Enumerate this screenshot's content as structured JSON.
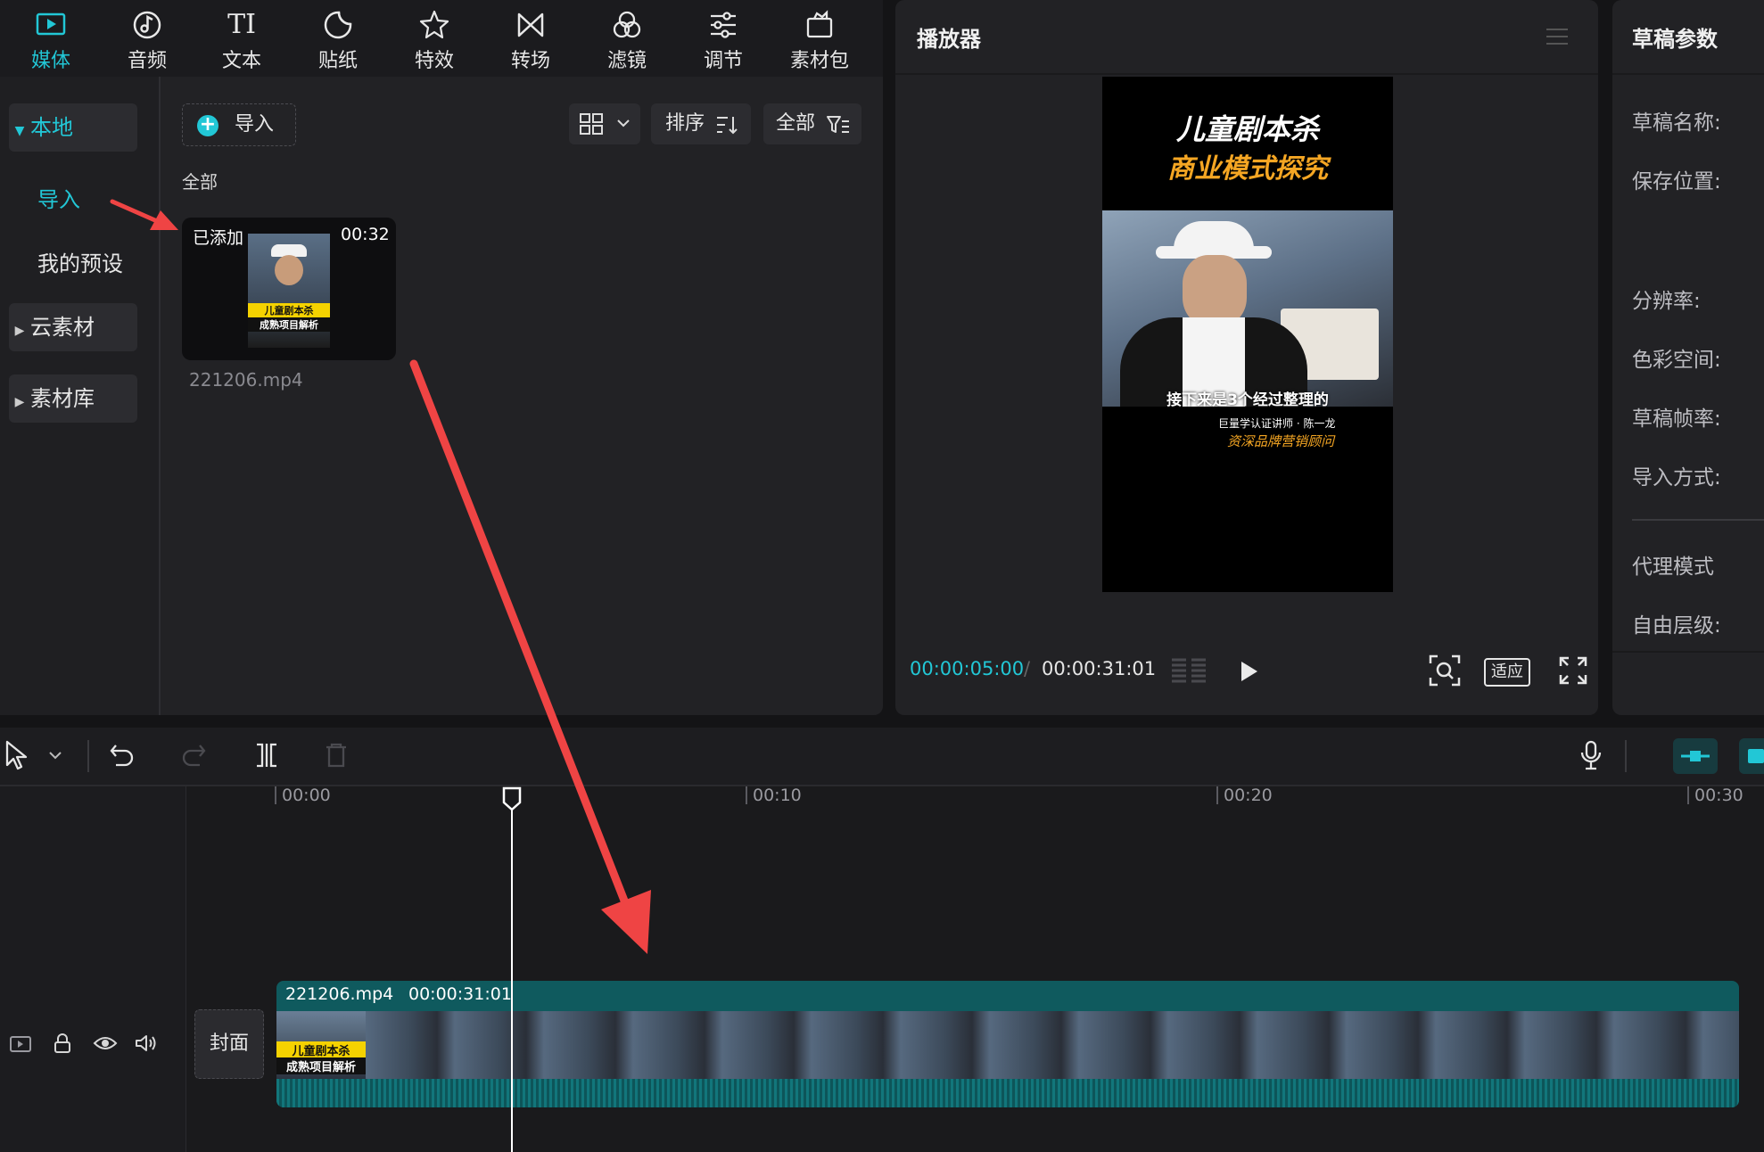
{
  "toolbar": {
    "tabs": [
      {
        "label": "媒体",
        "icon": "media-icon",
        "active": true
      },
      {
        "label": "音频",
        "icon": "audio-icon"
      },
      {
        "label": "文本",
        "icon": "text-icon"
      },
      {
        "label": "贴纸",
        "icon": "sticker-icon"
      },
      {
        "label": "特效",
        "icon": "effects-icon"
      },
      {
        "label": "转场",
        "icon": "transition-icon"
      },
      {
        "label": "滤镜",
        "icon": "filter-icon"
      },
      {
        "label": "调节",
        "icon": "adjust-icon"
      },
      {
        "label": "素材包",
        "icon": "material-pack-icon"
      }
    ],
    "text_glyph": "TI"
  },
  "sidebar": {
    "local": "本地",
    "import": "导入",
    "presets": "我的预设",
    "cloud": "云素材",
    "library": "素材库"
  },
  "media": {
    "import_button": "导入",
    "sort_label": "排序",
    "filter_label": "全部",
    "section_title": "全部",
    "clip": {
      "badge": "已添加",
      "duration": "00:32",
      "filename": "221206.mp4",
      "thumb_line1": "儿童剧本杀",
      "thumb_line2": "成熟项目解析"
    }
  },
  "player": {
    "title": "播放器",
    "video_title1": "儿童剧本杀",
    "video_title2": "商业模式探究",
    "subtitle": "接下来是3个经过整理的",
    "credit1": "巨量学认证讲师 · 陈一龙",
    "credit2": "资深品牌营销顾问",
    "time_current": "00:00:05:00",
    "time_separator": "/",
    "time_total": "00:00:31:01",
    "fit_label": "适应"
  },
  "draft": {
    "title": "草稿参数",
    "fields": [
      "草稿名称:",
      "保存位置:",
      "分辨率:",
      "色彩空间:",
      "草稿帧率:",
      "导入方式:",
      "代理模式",
      "自由层级:"
    ]
  },
  "timeline": {
    "ruler": [
      "00:00",
      "00:10",
      "00:20",
      "00:30"
    ],
    "cover_label": "封面",
    "clip_name": "221206.mp4",
    "clip_duration": "00:00:31:01",
    "clip_thumb_line1": "儿童剧本杀",
    "clip_thumb_line2": "成熟项目解析"
  },
  "colors": {
    "accent": "#22c7d6",
    "annotation_arrow": "#ef4444",
    "clip_track": "#0f5a5e"
  }
}
